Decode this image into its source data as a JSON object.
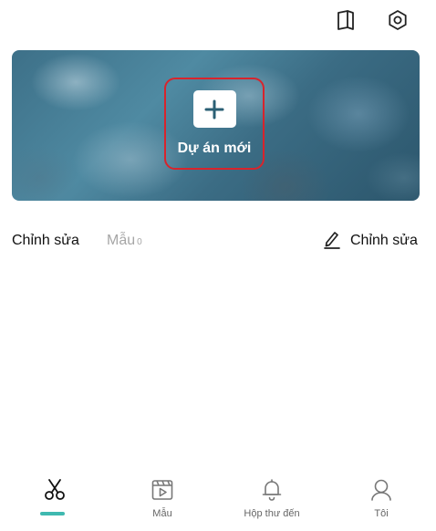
{
  "top_bar": {
    "icons": [
      "book-icon",
      "settings-icon"
    ]
  },
  "banner": {
    "new_project_label": "Dự án mới",
    "highlight_color": "#d8242c"
  },
  "tabs": {
    "edit_label": "Chỉnh sửa",
    "template_label": "Mẫu",
    "template_count": "0",
    "edit_action_label": "Chỉnh sửa"
  },
  "bottom_nav": {
    "items": [
      {
        "icon": "scissors-icon",
        "label": "",
        "active": true
      },
      {
        "icon": "template-play-icon",
        "label": "Mẫu",
        "active": false
      },
      {
        "icon": "bell-icon",
        "label": "Hộp thư đến",
        "active": false
      },
      {
        "icon": "user-icon",
        "label": "Tôi",
        "active": false
      }
    ],
    "active_color": "#3fb9b0"
  }
}
